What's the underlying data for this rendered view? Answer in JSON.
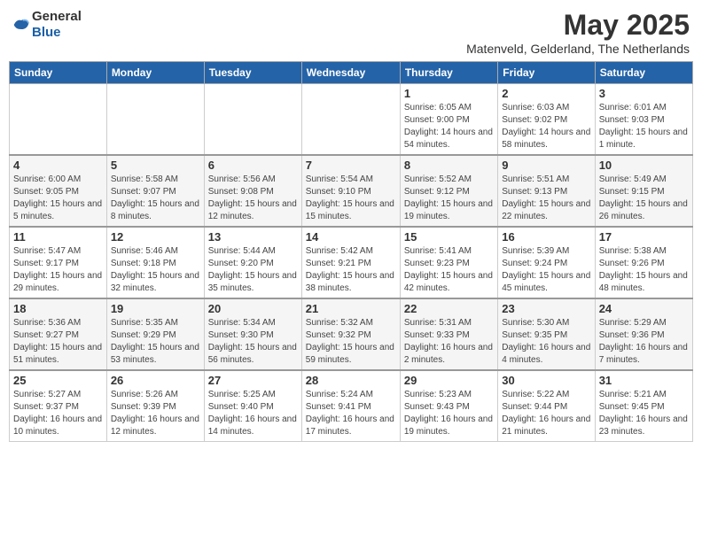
{
  "header": {
    "logo_general": "General",
    "logo_blue": "Blue",
    "month_title": "May 2025",
    "subtitle": "Matenveld, Gelderland, The Netherlands"
  },
  "days_of_week": [
    "Sunday",
    "Monday",
    "Tuesday",
    "Wednesday",
    "Thursday",
    "Friday",
    "Saturday"
  ],
  "weeks": [
    [
      {
        "day": "",
        "info": ""
      },
      {
        "day": "",
        "info": ""
      },
      {
        "day": "",
        "info": ""
      },
      {
        "day": "",
        "info": ""
      },
      {
        "day": "1",
        "info": "Sunrise: 6:05 AM\nSunset: 9:00 PM\nDaylight: 14 hours\nand 54 minutes."
      },
      {
        "day": "2",
        "info": "Sunrise: 6:03 AM\nSunset: 9:02 PM\nDaylight: 14 hours\nand 58 minutes."
      },
      {
        "day": "3",
        "info": "Sunrise: 6:01 AM\nSunset: 9:03 PM\nDaylight: 15 hours\nand 1 minute."
      }
    ],
    [
      {
        "day": "4",
        "info": "Sunrise: 6:00 AM\nSunset: 9:05 PM\nDaylight: 15 hours\nand 5 minutes."
      },
      {
        "day": "5",
        "info": "Sunrise: 5:58 AM\nSunset: 9:07 PM\nDaylight: 15 hours\nand 8 minutes."
      },
      {
        "day": "6",
        "info": "Sunrise: 5:56 AM\nSunset: 9:08 PM\nDaylight: 15 hours\nand 12 minutes."
      },
      {
        "day": "7",
        "info": "Sunrise: 5:54 AM\nSunset: 9:10 PM\nDaylight: 15 hours\nand 15 minutes."
      },
      {
        "day": "8",
        "info": "Sunrise: 5:52 AM\nSunset: 9:12 PM\nDaylight: 15 hours\nand 19 minutes."
      },
      {
        "day": "9",
        "info": "Sunrise: 5:51 AM\nSunset: 9:13 PM\nDaylight: 15 hours\nand 22 minutes."
      },
      {
        "day": "10",
        "info": "Sunrise: 5:49 AM\nSunset: 9:15 PM\nDaylight: 15 hours\nand 26 minutes."
      }
    ],
    [
      {
        "day": "11",
        "info": "Sunrise: 5:47 AM\nSunset: 9:17 PM\nDaylight: 15 hours\nand 29 minutes."
      },
      {
        "day": "12",
        "info": "Sunrise: 5:46 AM\nSunset: 9:18 PM\nDaylight: 15 hours\nand 32 minutes."
      },
      {
        "day": "13",
        "info": "Sunrise: 5:44 AM\nSunset: 9:20 PM\nDaylight: 15 hours\nand 35 minutes."
      },
      {
        "day": "14",
        "info": "Sunrise: 5:42 AM\nSunset: 9:21 PM\nDaylight: 15 hours\nand 38 minutes."
      },
      {
        "day": "15",
        "info": "Sunrise: 5:41 AM\nSunset: 9:23 PM\nDaylight: 15 hours\nand 42 minutes."
      },
      {
        "day": "16",
        "info": "Sunrise: 5:39 AM\nSunset: 9:24 PM\nDaylight: 15 hours\nand 45 minutes."
      },
      {
        "day": "17",
        "info": "Sunrise: 5:38 AM\nSunset: 9:26 PM\nDaylight: 15 hours\nand 48 minutes."
      }
    ],
    [
      {
        "day": "18",
        "info": "Sunrise: 5:36 AM\nSunset: 9:27 PM\nDaylight: 15 hours\nand 51 minutes."
      },
      {
        "day": "19",
        "info": "Sunrise: 5:35 AM\nSunset: 9:29 PM\nDaylight: 15 hours\nand 53 minutes."
      },
      {
        "day": "20",
        "info": "Sunrise: 5:34 AM\nSunset: 9:30 PM\nDaylight: 15 hours\nand 56 minutes."
      },
      {
        "day": "21",
        "info": "Sunrise: 5:32 AM\nSunset: 9:32 PM\nDaylight: 15 hours\nand 59 minutes."
      },
      {
        "day": "22",
        "info": "Sunrise: 5:31 AM\nSunset: 9:33 PM\nDaylight: 16 hours\nand 2 minutes."
      },
      {
        "day": "23",
        "info": "Sunrise: 5:30 AM\nSunset: 9:35 PM\nDaylight: 16 hours\nand 4 minutes."
      },
      {
        "day": "24",
        "info": "Sunrise: 5:29 AM\nSunset: 9:36 PM\nDaylight: 16 hours\nand 7 minutes."
      }
    ],
    [
      {
        "day": "25",
        "info": "Sunrise: 5:27 AM\nSunset: 9:37 PM\nDaylight: 16 hours\nand 10 minutes."
      },
      {
        "day": "26",
        "info": "Sunrise: 5:26 AM\nSunset: 9:39 PM\nDaylight: 16 hours\nand 12 minutes."
      },
      {
        "day": "27",
        "info": "Sunrise: 5:25 AM\nSunset: 9:40 PM\nDaylight: 16 hours\nand 14 minutes."
      },
      {
        "day": "28",
        "info": "Sunrise: 5:24 AM\nSunset: 9:41 PM\nDaylight: 16 hours\nand 17 minutes."
      },
      {
        "day": "29",
        "info": "Sunrise: 5:23 AM\nSunset: 9:43 PM\nDaylight: 16 hours\nand 19 minutes."
      },
      {
        "day": "30",
        "info": "Sunrise: 5:22 AM\nSunset: 9:44 PM\nDaylight: 16 hours\nand 21 minutes."
      },
      {
        "day": "31",
        "info": "Sunrise: 5:21 AM\nSunset: 9:45 PM\nDaylight: 16 hours\nand 23 minutes."
      }
    ]
  ]
}
